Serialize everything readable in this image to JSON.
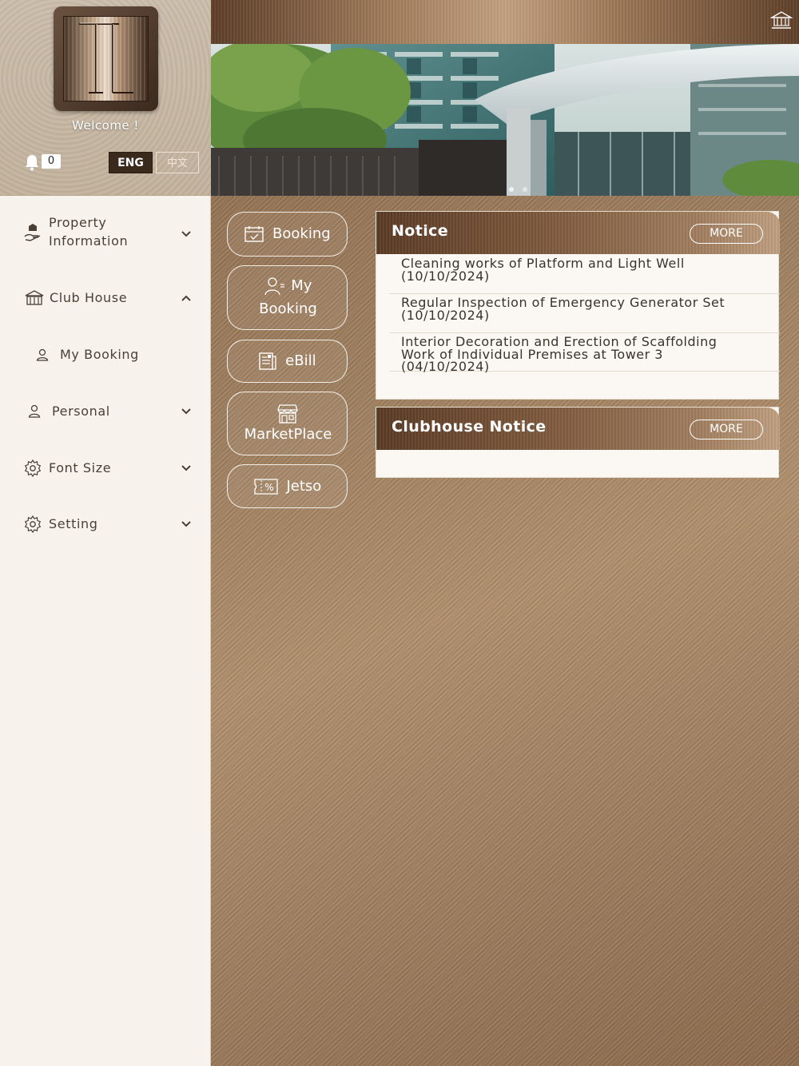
{
  "sidebar": {
    "welcome": "Welcome !",
    "notification_count": "0",
    "lang_en": "ENG",
    "lang_zh": "中文",
    "menu": [
      {
        "label_line1": "Property",
        "label_line2": "Information",
        "icon": "hand-house-icon",
        "expanded": false
      },
      {
        "label": "Club House",
        "icon": "clubhouse-icon",
        "expanded": true
      },
      {
        "label": "My Booking",
        "icon": "person-icon"
      },
      {
        "label": "Personal",
        "icon": "person-icon",
        "expanded": false
      },
      {
        "label": "Font Size",
        "icon": "gear-icon",
        "expanded": false
      },
      {
        "label": "Setting",
        "icon": "gear-icon",
        "expanded": false
      }
    ]
  },
  "quick": {
    "booking": "Booking",
    "my_booking_1": "My",
    "my_booking_2": "Booking",
    "ebill": "eBill",
    "marketplace": "MarketPlace",
    "jetso": "Jetso"
  },
  "notice": {
    "title": "Notice",
    "more": "MORE",
    "items": [
      {
        "line1": "Cleaning works of Platform and Light Well",
        "line2": "(10/10/2024)"
      },
      {
        "line1": "Regular Inspection of Emergency Generator Set",
        "line2": "(10/10/2024)"
      },
      {
        "line1": "Interior Decoration and Erection of Scaffolding",
        "line2": "Work of Individual Premises at Tower 3",
        "line3": "(04/10/2024)"
      }
    ]
  },
  "clubhouse_notice": {
    "title": "Clubhouse Notice",
    "more": "MORE"
  },
  "colors": {
    "accent_dark": "#3a2a1c",
    "bronze": "#a0805f",
    "sidebar_bg": "#f7f3ec"
  }
}
